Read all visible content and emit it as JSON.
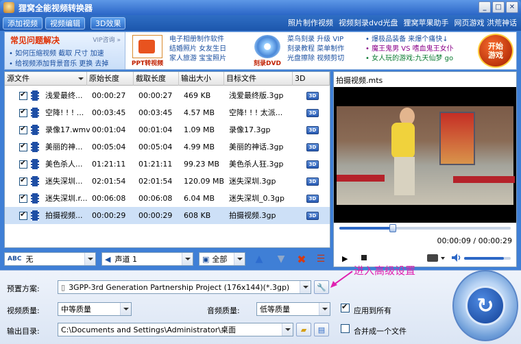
{
  "window": {
    "title": "狸窝全能视频转换器"
  },
  "menubar": {
    "buttons": [
      "添加视频",
      "视频编辑",
      "3D效果"
    ],
    "links": [
      "照片制作视频",
      "视频刻录dvd光盘",
      "狸窝苹果助手",
      "网页游戏 洪荒神话"
    ]
  },
  "ads": {
    "faq_title": "常见问题解决",
    "faq_vip": "VIP咨询 »",
    "faq_lines": [
      "• 如何压缩视频 截取 尺寸 加速",
      "• 给视频添加背景音乐 更换 去掉"
    ],
    "ppt_label": "PPT转视频",
    "col1": [
      "电子相册制作软件",
      "结婚照片 女友生日",
      "家人旅游 宝宝照片"
    ],
    "dvd_label": "刻录DVD",
    "col2": [
      "菜鸟刻录 升级 VIP",
      "刻录教程 菜单制作",
      "光盘擦除 视频剪切"
    ],
    "col3": [
      "• 爆极品装备 来爆个痛快↓",
      "• 魔王鬼男 VS 嗜血鬼王女仆",
      "• 女人玩的游戏:九天仙梦 go"
    ],
    "start_game": [
      "开始",
      "游戏"
    ]
  },
  "list": {
    "headers": [
      "源文件",
      "原始长度",
      "截取长度",
      "输出大小",
      "目标文件",
      "3D"
    ],
    "rows": [
      {
        "src": "浅爱最终...",
        "orig": "00:00:27",
        "cut": "00:00:27",
        "size": "469 KB",
        "target": "浅爱最终版.3gp",
        "three_d": "3D"
      },
      {
        "src": "空降! ! ! ...",
        "orig": "00:03:45",
        "cut": "00:03:45",
        "size": "4.57 MB",
        "target": "空降! ! ! 太派...",
        "three_d": "3D"
      },
      {
        "src": "录像17.wmv",
        "orig": "00:01:04",
        "cut": "00:01:04",
        "size": "1.09 MB",
        "target": "录像17.3gp",
        "three_d": "3D"
      },
      {
        "src": "美丽的神...",
        "orig": "00:05:04",
        "cut": "00:05:04",
        "size": "4.99 MB",
        "target": "美丽的神话.3gp",
        "three_d": "3D"
      },
      {
        "src": "美色杀人...",
        "orig": "01:21:11",
        "cut": "01:21:11",
        "size": "99.23 MB",
        "target": "美色杀人狂.3gp",
        "three_d": "3D"
      },
      {
        "src": "迷失深圳...",
        "orig": "02:01:54",
        "cut": "02:01:54",
        "size": "120.09 MB",
        "target": "迷失深圳.3gp",
        "three_d": "3D"
      },
      {
        "src": "迷失深圳.r...",
        "orig": "00:06:08",
        "cut": "00:06:08",
        "size": "6.04 MB",
        "target": "迷失深圳_0.3gp",
        "three_d": "3D"
      },
      {
        "src": "拍摄视频...",
        "orig": "00:00:29",
        "cut": "00:00:29",
        "size": "608 KB",
        "target": "拍摄视频.3gp",
        "three_d": "3D"
      }
    ],
    "subtitle_select": "无",
    "audio_select": "声道 1",
    "all_select": "全部"
  },
  "preview": {
    "title": "拍摄视频.mts",
    "time": "00:00:09 / 00:00:29",
    "progress": 0.31,
    "volume": 0.85
  },
  "settings": {
    "preset_label": "预置方案:",
    "preset_value": "3GPP-3rd Generation Partnership Project (176x144)(*.3gp)",
    "video_quality_label": "视频质量:",
    "video_quality_value": "中等质量",
    "audio_quality_label": "音频质量:",
    "audio_quality_value": "低等质量",
    "apply_all_label": "应用到所有",
    "output_label": "输出目录:",
    "output_value": "C:\\Documents and Settings\\Administrator\\桌面",
    "merge_label": "合并成一个文件",
    "annotation": "进入高级设置"
  }
}
